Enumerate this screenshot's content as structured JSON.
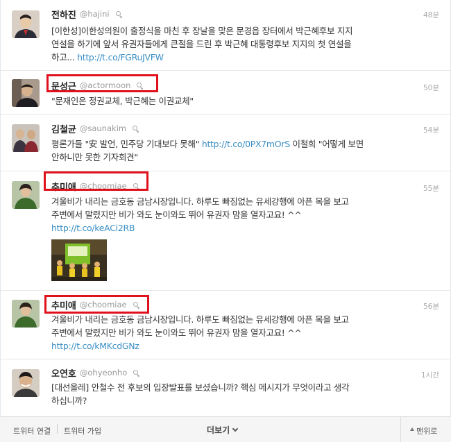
{
  "tweets": [
    {
      "name": "전하진",
      "handle": "@hajini",
      "time": "48분",
      "lines": [
        "[이한성]이한성의원이 출정식을 마친 후 장날을 맞은 문경읍 장터에서 박근혜후보 지지",
        "연설을 하기에 앞서 유권자들에게 큰절을 드린 후 박근혜 대통령후보 지지의 첫 연설을",
        "하고..."
      ],
      "link": "http://t.co/FGRuJVFW",
      "avatar_color": "#8a6a55"
    },
    {
      "name": "문성근",
      "handle": "@actormoon",
      "time": "50분",
      "lines": [
        "\"문재인은 정권교체, 박근혜는 이권교체\""
      ],
      "avatar_color": "#5a4a42"
    },
    {
      "name": "김철균",
      "handle": "@saunakim",
      "time": "54분",
      "line1_pre": "평론가들 \"安 발언, 민주당 기대보다 못해\" ",
      "line1_link": "http://t.co/0PX7mOrS",
      "line1_post": " 이철희 \"어떻게 보면",
      "line2": "안하니만 못한 기자회견\"",
      "avatar_color": "#6b5a50"
    },
    {
      "name": "추미애",
      "handle": "@choomiae",
      "time": "55분",
      "lines": [
        "겨울비가 내리는 금호동 금남시장입니다. 하루도 빠짐없는 유세강행에 아픈 목을 보고",
        "주변에서 말렸지만 비가 와도 눈이와도 뛰어 유권자 맘을 열자고요! ^^"
      ],
      "link": "http://t.co/keACi2RB",
      "avatar_color": "#4a6b3a"
    },
    {
      "name": "추미애",
      "handle": "@choomiae",
      "time": "56분",
      "lines": [
        "겨울비가 내리는 금호동 금남시장입니다. 하루도 빠짐없는 유세강행에 아픈 목을 보고",
        "주변에서 말렸지만 비가 와도 눈이와도 뛰어 유권자 맘을 열자고요! ^^"
      ],
      "link": "http://t.co/kMKcdGNz",
      "avatar_color": "#4a6b3a"
    },
    {
      "name": "오연호",
      "handle": "@ohyeonho",
      "time": "1시간",
      "lines": [
        "[대선올레] 안철수 전 후보의 입장발표를 보셨습니까? 핵심 메시지가 무엇이라고 생각",
        "하십니까?"
      ],
      "avatar_color": "#7a6a60"
    }
  ],
  "footer": {
    "connect": "트위터 연결",
    "signup": "트위터 가입",
    "more": "더보기",
    "to_top": "맨위로"
  },
  "colors": {
    "highlight_box": "#e0101c",
    "link": "#3b8fc6",
    "footer_bg": "#f5f5f5"
  }
}
